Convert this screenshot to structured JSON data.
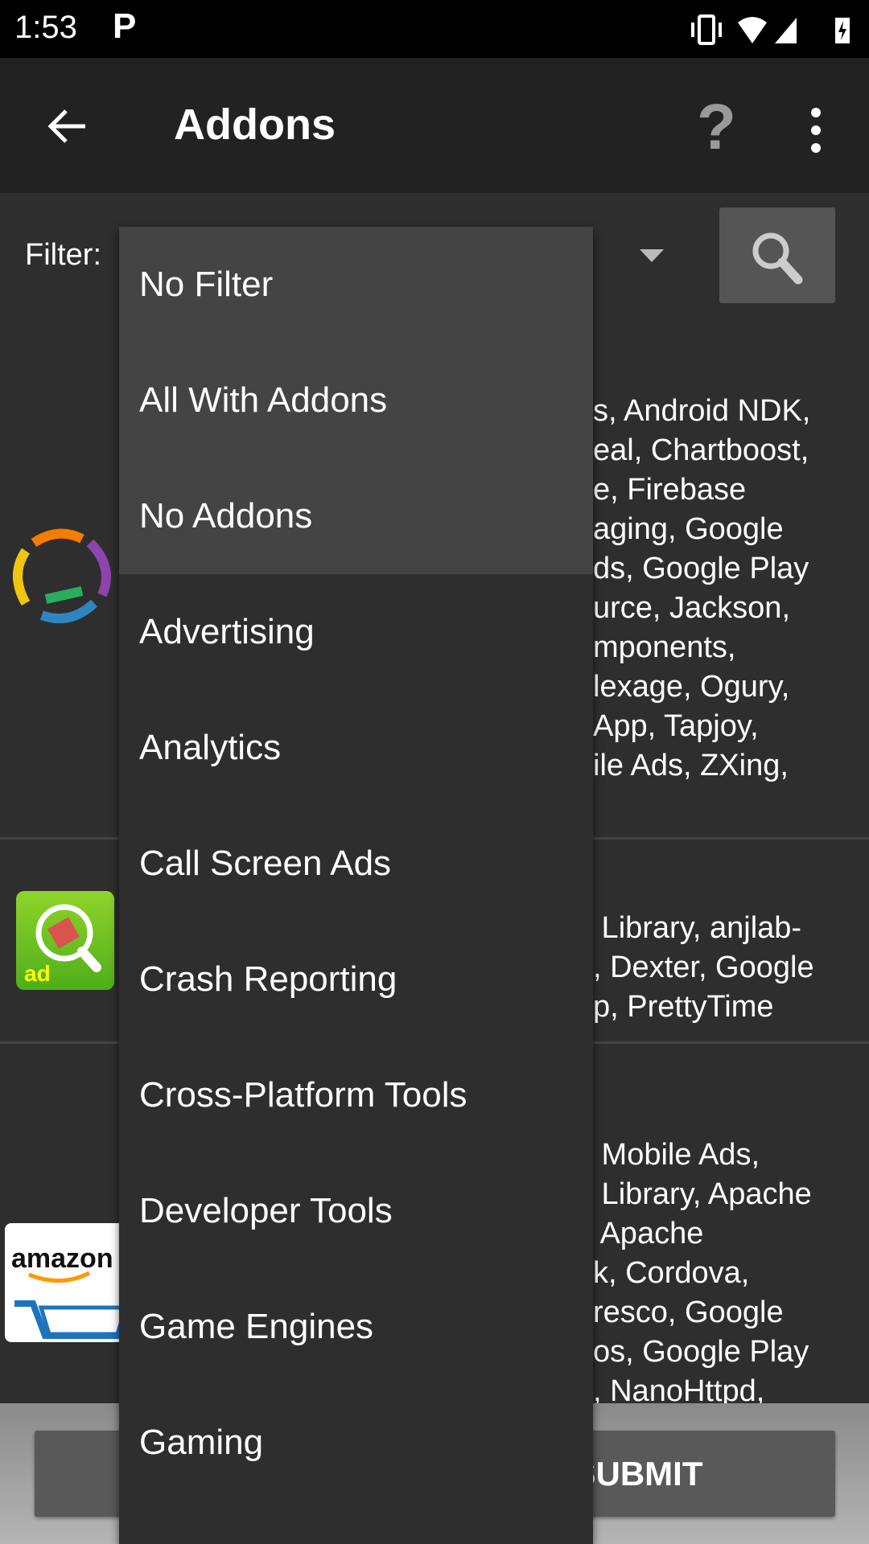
{
  "status_bar": {
    "time": "1:53",
    "notification_icon": "parking-p-icon",
    "icons": [
      "vibrate-icon",
      "wifi-icon",
      "signal-icon",
      "battery-charging-icon"
    ]
  },
  "toolbar": {
    "title": "Addons",
    "back_icon": "arrow-left-icon",
    "help_icon": "question-mark-icon",
    "menu_icon": "more-vert-icon"
  },
  "filter": {
    "label": "Filter:",
    "selected": "No Filter",
    "search_icon": "magnifier-icon"
  },
  "rows": [
    {
      "icon": "arrows-circle-icon",
      "text_fragments": [
        "s, Android NDK,",
        "eal, Chartboost,",
        "e, Firebase",
        "aging, Google",
        "ds, Google Play",
        "urce, Jackson,",
        "mponents,",
        "lexage, Ogury,",
        "App, Tapjoy,",
        "ile Ads, ZXing,"
      ]
    },
    {
      "icon": "addons-detector-icon",
      "text_fragments": [
        " Library, anjlab-",
        ", Dexter, Google",
        "p, PrettyTime"
      ]
    },
    {
      "icon": "amazon-cart-icon",
      "text_fragments": [
        " Mobile Ads,",
        " Library, Apache",
        " Apache",
        "k, Cordova,",
        "resco, Google",
        "os, Google Play",
        ", NanoHttpd,"
      ]
    }
  ],
  "bottom": {
    "left_button": "",
    "submit_button": "SUBMIT"
  },
  "dropdown": {
    "items": [
      "No Filter",
      "All With Addons",
      "No Addons",
      "Advertising",
      "Analytics",
      "Call Screen Ads",
      "Crash Reporting",
      "Cross-Platform Tools",
      "Developer Tools",
      "Game Engines",
      "Gaming"
    ]
  },
  "colors": {
    "toolbar": "#222222",
    "background": "#2e2e2e",
    "dropdown_highlight": "#444444",
    "search_button": "#555555"
  }
}
